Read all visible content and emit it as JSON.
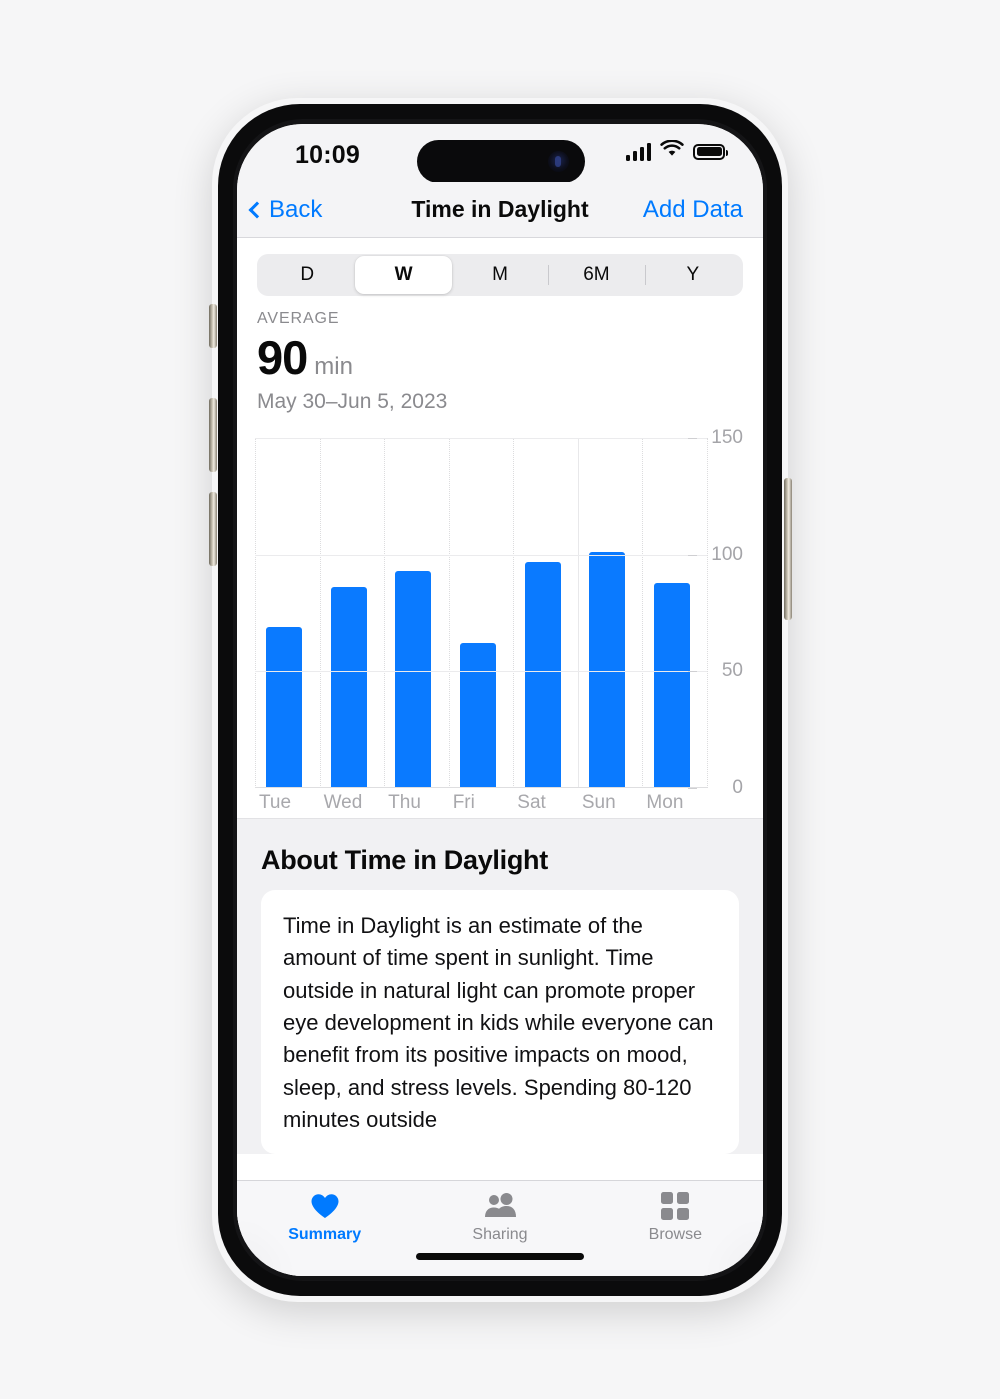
{
  "statusbar": {
    "time": "10:09",
    "cellular_icon": "cellular-bars-icon",
    "wifi_icon": "wifi-icon",
    "battery_icon": "battery-full-icon"
  },
  "navbar": {
    "back_label": "Back",
    "title": "Time in Daylight",
    "action_label": "Add Data"
  },
  "segmented": {
    "options": [
      "D",
      "W",
      "M",
      "6M",
      "Y"
    ],
    "selected": "W"
  },
  "stats": {
    "label": "AVERAGE",
    "value": "90",
    "unit": "min",
    "range": "May 30–Jun 5, 2023"
  },
  "about": {
    "title": "About Time in Daylight",
    "body": "Time in Daylight is an estimate of the amount of time spent in sunlight. Time outside in natural light can promote proper eye development in kids while everyone can benefit from its positive impacts on mood, sleep, and stress levels. Spending 80-120 minutes outside"
  },
  "tabbar": {
    "tabs": [
      {
        "label": "Summary",
        "icon": "heart-icon",
        "active": true
      },
      {
        "label": "Sharing",
        "icon": "people-icon",
        "active": false
      },
      {
        "label": "Browse",
        "icon": "grid-squares-icon",
        "active": false
      }
    ]
  },
  "colors": {
    "accent": "#007aff",
    "bar": "#0a7aff",
    "muted": "#8a8a8e"
  },
  "chart_data": {
    "type": "bar",
    "title": "Time in Daylight",
    "categories": [
      "Tue",
      "Wed",
      "Thu",
      "Fri",
      "Sat",
      "Sun",
      "Mon"
    ],
    "values": [
      69,
      86,
      93,
      62,
      97,
      101,
      88
    ],
    "unit": "min",
    "xlabel": "",
    "ylabel": "",
    "ylim": [
      0,
      150
    ],
    "yticks": [
      0,
      50,
      100,
      150
    ],
    "ytick_labels": [
      "0",
      "50",
      "100",
      "150"
    ],
    "grid": true,
    "legend": false,
    "average": 90
  }
}
